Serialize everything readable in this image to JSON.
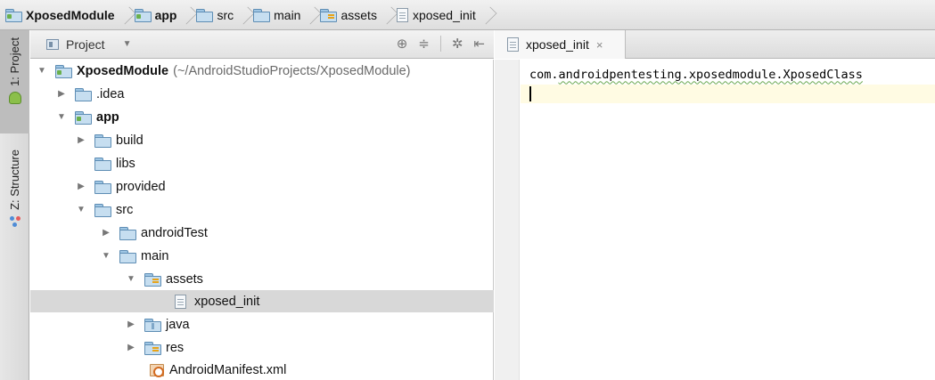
{
  "breadcrumb": [
    {
      "label": "XposedModule",
      "icon": "module-folder-icon",
      "bold": true
    },
    {
      "label": "app",
      "icon": "module-folder-icon",
      "bold": true
    },
    {
      "label": "src",
      "icon": "folder-icon",
      "bold": false
    },
    {
      "label": "main",
      "icon": "folder-icon",
      "bold": false
    },
    {
      "label": "assets",
      "icon": "resource-folder-icon",
      "bold": false
    },
    {
      "label": "xposed_init",
      "icon": "file-icon",
      "bold": false
    }
  ],
  "toolstrip": {
    "project_tab": "1: Project",
    "structure_tab": "Z: Structure"
  },
  "project_panel": {
    "title": "Project",
    "tree": [
      {
        "label": "XposedModule",
        "path": "(~/AndroidStudioProjects/XposedModule)",
        "expanded": true
      },
      {
        "label": ".idea",
        "expanded": false
      },
      {
        "label": "app",
        "expanded": true
      },
      {
        "label": "build",
        "expanded": false
      },
      {
        "label": "libs"
      },
      {
        "label": "provided",
        "expanded": false
      },
      {
        "label": "src",
        "expanded": true
      },
      {
        "label": "androidTest",
        "expanded": false
      },
      {
        "label": "main",
        "expanded": true
      },
      {
        "label": "assets",
        "expanded": true
      },
      {
        "label": "xposed_init",
        "selected": true
      },
      {
        "label": "java",
        "expanded": false
      },
      {
        "label": "res",
        "expanded": false
      },
      {
        "label": "AndroidManifest.xml"
      }
    ]
  },
  "editor": {
    "tab_label": "xposed_init",
    "tab_close": "×",
    "lines": [
      {
        "prefix": "com.",
        "rest": "androidpentesting.xposedmodule.XposedClass"
      },
      {
        "prefix": "",
        "rest": ""
      }
    ]
  },
  "colors": {
    "selection": "#d8d8d8",
    "current_line": "#fffbe3",
    "folder_blue": "#c6def0"
  }
}
